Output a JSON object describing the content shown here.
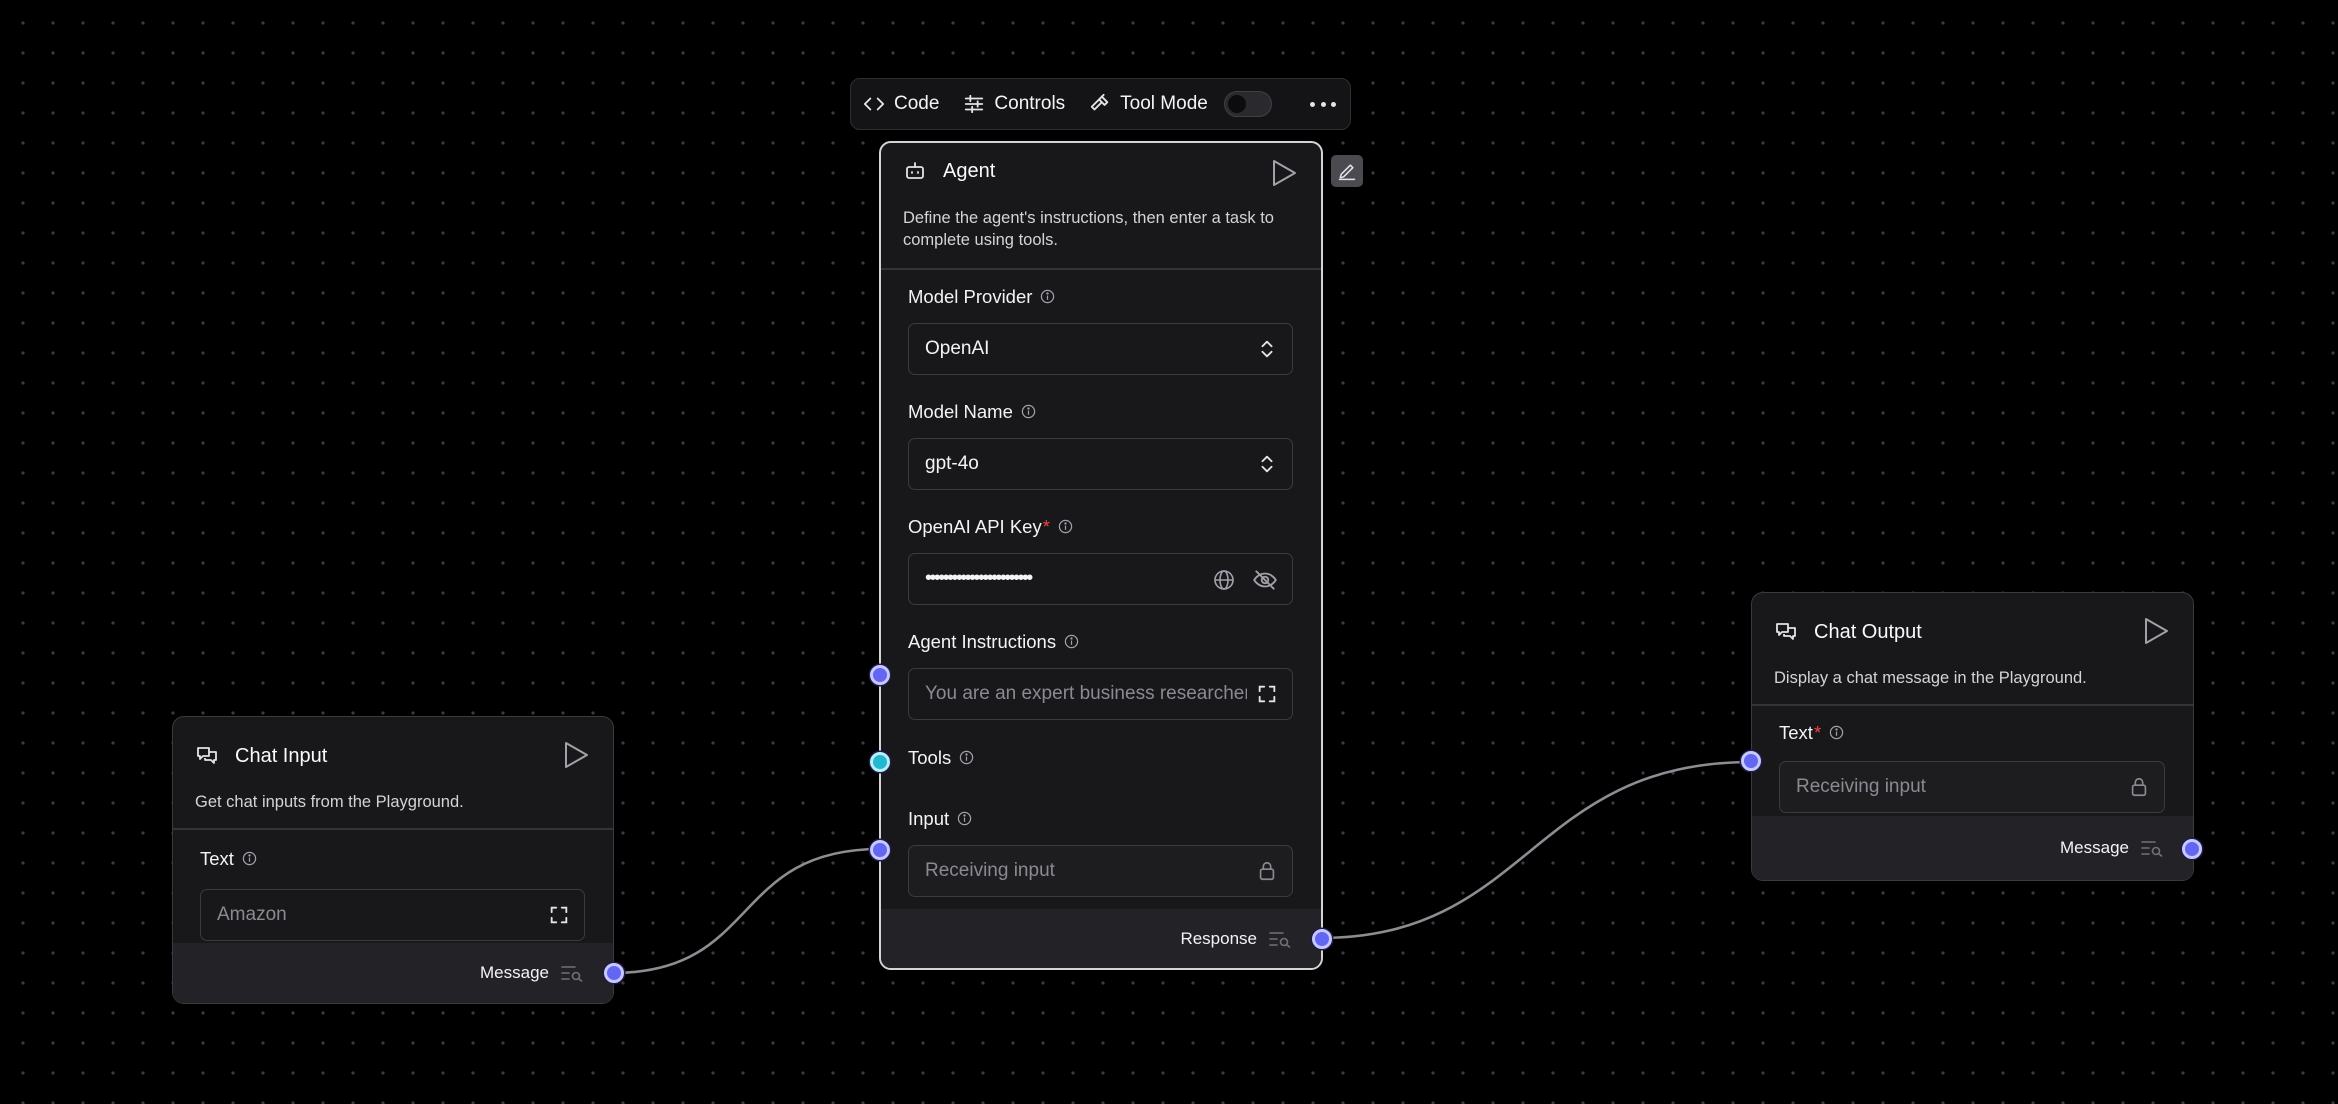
{
  "toolbar": {
    "code_label": "Code",
    "controls_label": "Controls",
    "tool_mode_label": "Tool Mode",
    "tool_mode_enabled": false
  },
  "chat_input": {
    "title": "Chat Input",
    "description": "Get chat inputs from the Playground.",
    "text_label": "Text",
    "text_value": "Amazon",
    "output_label": "Message"
  },
  "agent": {
    "title": "Agent",
    "description": "Define the agent's instructions, then enter a task to complete using tools.",
    "model_provider_label": "Model Provider",
    "model_provider_value": "OpenAI",
    "model_name_label": "Model Name",
    "model_name_value": "gpt-4o",
    "api_key_label": "OpenAI API Key",
    "api_key_required": "*",
    "api_key_masked": "••••••••••••••••••••••••",
    "instructions_label": "Agent Instructions",
    "instructions_placeholder": "You are an expert business researcher",
    "tools_label": "Tools",
    "input_label": "Input",
    "input_placeholder": "Receiving input",
    "output_label": "Response"
  },
  "chat_output": {
    "title": "Chat Output",
    "description": "Display a chat message in the Playground.",
    "text_label": "Text",
    "text_required": "*",
    "text_placeholder": "Receiving input",
    "output_label": "Message"
  },
  "colors": {
    "handle": "#6366f1",
    "tools_handle": "#22b8cf",
    "required": "#ef4444",
    "edge": "#8c8c92"
  },
  "icons": [
    "code-icon",
    "sliders-icon",
    "hammer-icon",
    "more-icon",
    "pencil-icon",
    "bot-icon",
    "chat-icon",
    "play-icon",
    "info-icon",
    "chevrons-up-down-icon",
    "globe-icon",
    "eye-off-icon",
    "expand-icon",
    "lock-icon",
    "message-list-icon"
  ]
}
